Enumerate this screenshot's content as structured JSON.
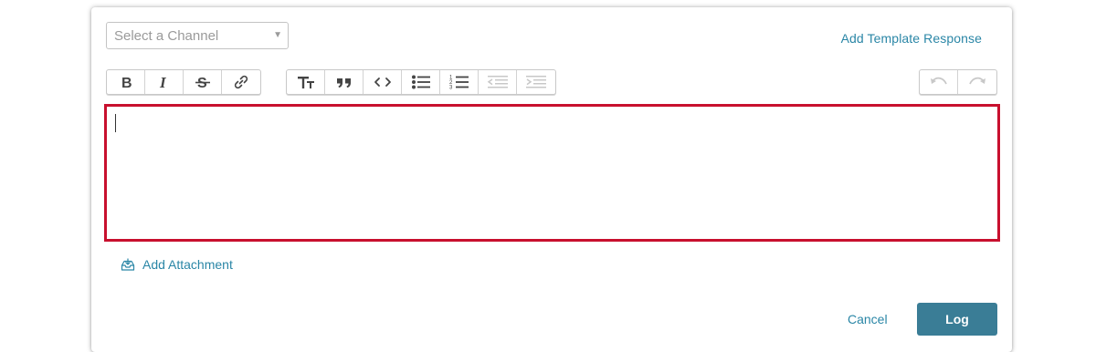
{
  "composer": {
    "channel_select": {
      "placeholder": "Select a Channel",
      "icon": "caret-down-icon"
    },
    "template_link": "Add Template Response",
    "toolbar": {
      "inline_group": [
        {
          "name": "bold",
          "icon": "bold-icon"
        },
        {
          "name": "italic",
          "icon": "italic-icon"
        },
        {
          "name": "strikethrough",
          "icon": "strikethrough-icon"
        },
        {
          "name": "link",
          "icon": "link-icon"
        }
      ],
      "block_group": [
        {
          "name": "heading",
          "icon": "heading-icon"
        },
        {
          "name": "quote",
          "icon": "quote-icon"
        },
        {
          "name": "code",
          "icon": "code-icon"
        },
        {
          "name": "bullet-list",
          "icon": "bullet-list-icon"
        },
        {
          "name": "numbered-list",
          "icon": "numbered-list-icon"
        },
        {
          "name": "outdent",
          "icon": "outdent-icon",
          "disabled": true
        },
        {
          "name": "indent",
          "icon": "indent-icon",
          "disabled": true
        }
      ],
      "history_group": [
        {
          "name": "undo",
          "icon": "undo-icon",
          "disabled": true
        },
        {
          "name": "redo",
          "icon": "redo-icon",
          "disabled": true
        }
      ]
    },
    "editor": {
      "value": "",
      "border_color": "#c8102e"
    },
    "attachment_label": "Add Attachment",
    "cancel_label": "Cancel",
    "log_label": "Log",
    "colors": {
      "link": "#2a86a6",
      "primary_button": "#3a7d96",
      "error_border": "#c8102e"
    }
  }
}
